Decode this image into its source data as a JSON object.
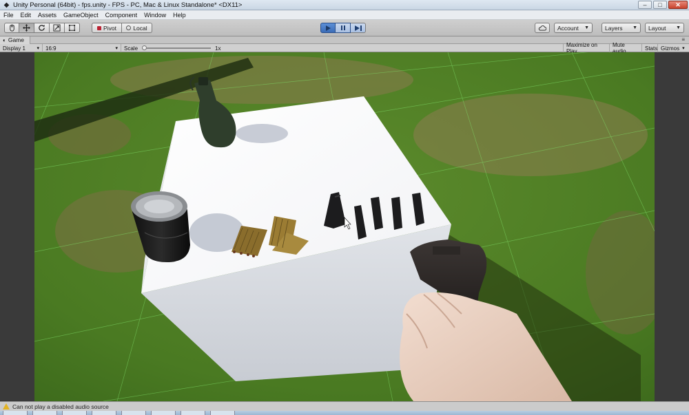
{
  "window": {
    "title": "Unity Personal (64bit) - fps.unity - FPS - PC, Mac & Linux Standalone* <DX11>",
    "controls": [
      "minimize",
      "maximize",
      "close"
    ]
  },
  "menu": [
    "File",
    "Edit",
    "Assets",
    "GameObject",
    "Component",
    "Window",
    "Help"
  ],
  "toolbar": {
    "tools": [
      "hand-tool",
      "move-tool",
      "rotate-tool",
      "scale-tool",
      "rect-tool"
    ],
    "pivot_label": "Pivot",
    "local_label": "Local",
    "account_label": "Account",
    "layers_label": "Layers",
    "layout_label": "Layout",
    "play_state": "playing"
  },
  "game_view": {
    "tab_label": "Game",
    "display_label": "Display 1",
    "aspect_label": "16:9",
    "scale_label": "Scale",
    "scale_value": "1x",
    "scale_fraction": 0.0,
    "maximize_on_play": "Maximize on Play",
    "mute_audio": "Mute audio",
    "stats": "Stats",
    "gizmos": "Gizmos"
  },
  "status": {
    "message": "Can not play a disabled audio source"
  },
  "colors": {
    "play_active": "#3b6cb8",
    "warning": "#e2b324",
    "grass": "#4b7a25"
  }
}
